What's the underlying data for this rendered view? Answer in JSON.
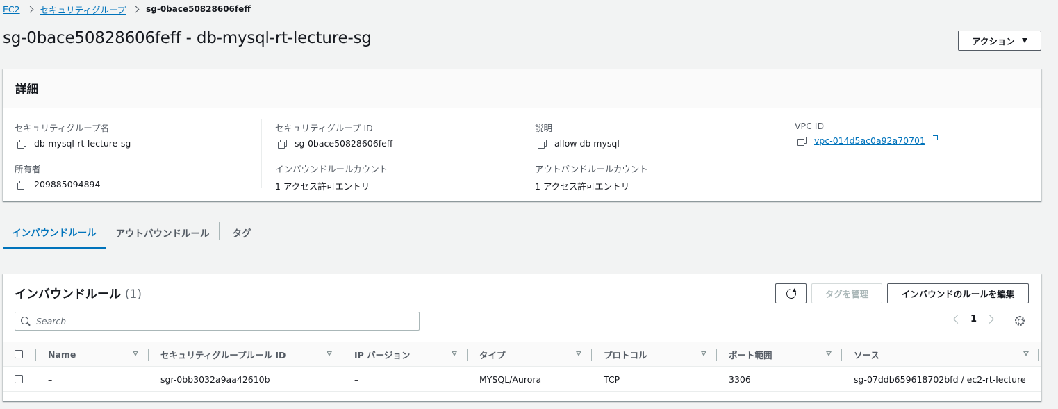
{
  "breadcrumb": {
    "items": [
      "EC2",
      "セキュリティグループ"
    ],
    "current": "sg-0bace50828606feff"
  },
  "page": {
    "title": "sg-0bace50828606feff - db-mysql-rt-lecture-sg",
    "actions_label": "アクション"
  },
  "details": {
    "header": "詳細",
    "fields": [
      {
        "label": "セキュリティグループ名",
        "value": "db-mysql-rt-lecture-sg"
      },
      {
        "label": "セキュリティグループ ID",
        "value": "sg-0bace50828606feff"
      },
      {
        "label": "説明",
        "value": "allow db mysql"
      },
      {
        "label": "VPC ID",
        "value": "vpc-014d5ac0a92a70701"
      },
      {
        "label": "所有者",
        "value": "209885094894"
      },
      {
        "label": "インバウンドルールカウント",
        "value": "1 アクセス許可エントリ"
      },
      {
        "label": "アウトバンドルールカウント",
        "value": "1 アクセス許可エントリ"
      }
    ]
  },
  "tabs": [
    "インバウンドルール",
    "アウトバウンドルール",
    "タグ"
  ],
  "rules": {
    "title": "インバウンドルール",
    "count": "(1)",
    "manage_tags_label": "タグを管理",
    "edit_label": "インバウンドのルールを編集",
    "search_placeholder": "Search",
    "page": "1",
    "columns": [
      "Name",
      "セキュリティグループルール ID",
      "IP バージョン",
      "タイプ",
      "プロトコル",
      "ポート範囲",
      "ソース"
    ],
    "rows": [
      {
        "name": "–",
        "rule_id": "sgr-0bb3032a9aa42610b",
        "ip_version": "–",
        "type": "MYSQL/Aurora",
        "protocol": "TCP",
        "port": "3306",
        "source": "sg-07ddb659618702bfd / ec2-rt-lecture…"
      }
    ]
  }
}
